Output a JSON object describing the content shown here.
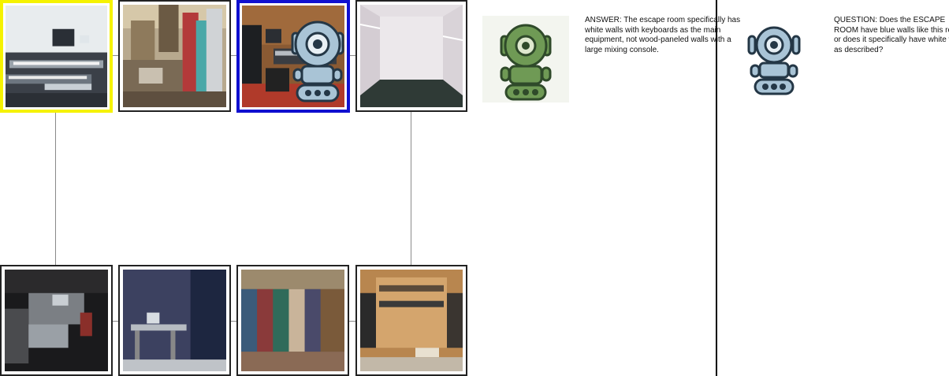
{
  "grid": {
    "top_row": [
      {
        "name": "image-tile-keyboard-studio",
        "highlight": "yellow"
      },
      {
        "name": "image-tile-cluttered-room",
        "highlight": "none"
      },
      {
        "name": "image-tile-wood-studio",
        "highlight": "blue"
      },
      {
        "name": "image-tile-empty-closet",
        "highlight": "none"
      }
    ],
    "bottom_row": [
      {
        "name": "image-tile-dark-studio",
        "highlight": "none"
      },
      {
        "name": "image-tile-blue-studio",
        "highlight": "none"
      },
      {
        "name": "image-tile-clothing-store",
        "highlight": "none"
      },
      {
        "name": "image-tile-walk-in-closet",
        "highlight": "none"
      }
    ]
  },
  "answer": {
    "text": "ANSWER: The escape room specifically has white walls with keyboards as the main equipment, not wood-paneled walls with a large mixing console.",
    "avatar": "green-robot-icon"
  },
  "question": {
    "text": "QUESTION: Does the ESCAPE ROOM have blue walls like this room, or does it specifically have white walls as described?",
    "avatar": "blue-robot-icon"
  },
  "colors": {
    "highlight_yellow": "#f5f200",
    "highlight_blue": "#1010d0",
    "robot_green": "#6f9a55",
    "robot_blue": "#a9c4d6"
  }
}
